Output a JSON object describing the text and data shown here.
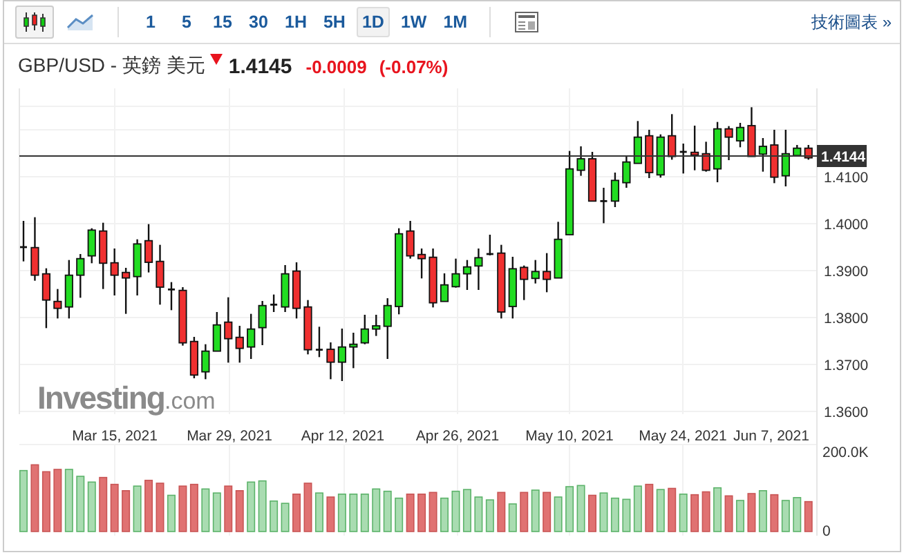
{
  "toolbar": {
    "chart_types": [
      {
        "kind": "candles",
        "selected": true
      },
      {
        "kind": "line",
        "selected": false
      }
    ],
    "intervals": [
      {
        "label": "1",
        "selected": false
      },
      {
        "label": "5",
        "selected": false
      },
      {
        "label": "15",
        "selected": false
      },
      {
        "label": "30",
        "selected": false
      },
      {
        "label": "1H",
        "selected": false
      },
      {
        "label": "5H",
        "selected": false
      },
      {
        "label": "1D",
        "selected": true
      },
      {
        "label": "1W",
        "selected": false
      },
      {
        "label": "1M",
        "selected": false
      }
    ],
    "link": "技術圖表 »"
  },
  "quote": {
    "title": "GBP/USD - 英鎊 美元",
    "falling": true,
    "price": "1.4145",
    "change": "-0.0009",
    "change_percent": "(-0.07%)"
  },
  "chart": {
    "price_axis": [
      "1.4100",
      "1.4000",
      "1.3900",
      "1.3800",
      "1.3700",
      "1.3600"
    ],
    "current_price": "1.4144",
    "date_axis": [
      "Mar 15, 2021",
      "Mar 29, 2021",
      "Apr 12, 2021",
      "Apr 26, 2021",
      "May 10, 2021",
      "May 24, 2021",
      "Jun 7, 2021"
    ],
    "volume_axis": [
      "200.0K",
      "0"
    ],
    "logo": {
      "name": "Investing",
      "suffix": ".com"
    }
  }
}
